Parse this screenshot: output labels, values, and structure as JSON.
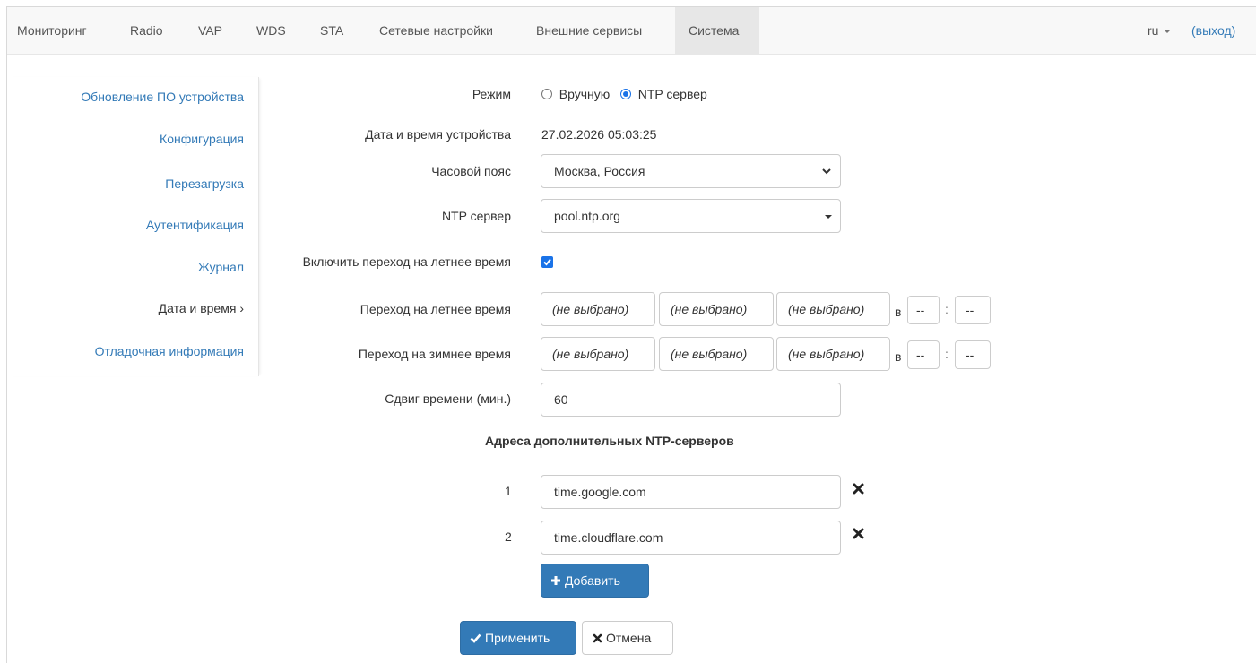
{
  "navbar": {
    "items": [
      "Мониторинг",
      "Radio",
      "VAP",
      "WDS",
      "STA",
      "Сетевые настройки",
      "Внешние сервисы",
      "Система"
    ],
    "active": "Система",
    "lang": "ru",
    "logout": "(выход)"
  },
  "sidebar": {
    "items": [
      "Обновление ПО устройства",
      "Конфигурация",
      "Перезагрузка",
      "Аутентификация",
      "Журнал",
      "Дата и время",
      "Отладочная информация"
    ],
    "current": "Дата и время",
    "current_arrow": "›"
  },
  "form": {
    "mode": {
      "label": "Режим",
      "options": [
        "Вручную",
        "NTP сервер"
      ],
      "selected": "NTP сервер"
    },
    "datetime": {
      "label": "Дата и время устройства",
      "value": "27.02.2026 05:03:25"
    },
    "timezone": {
      "label": "Часовой пояс",
      "value": "Москва, Россия"
    },
    "ntp_server": {
      "label": "NTP сервер",
      "value": "pool.ntp.org"
    },
    "dst_enable": {
      "label": "Включить переход на летнее время",
      "checked": true
    },
    "dst_start": {
      "label": "Переход на летнее время",
      "selects": [
        "(не выбрано)",
        "(не выбрано)",
        "(не выбрано)"
      ],
      "at": "в",
      "hour": "--",
      "sep": ":",
      "minute": "--"
    },
    "dst_end": {
      "label": "Переход на зимнее время",
      "selects": [
        "(не выбрано)",
        "(не выбрано)",
        "(не выбрано)"
      ],
      "at": "в",
      "hour": "--",
      "sep": ":",
      "minute": "--"
    },
    "shift": {
      "label": "Сдвиг времени (мин.)",
      "value": "60"
    },
    "extra_title": "Адреса дополнительных NTP-серверов",
    "extra_servers": [
      {
        "index": "1",
        "value": "time.google.com"
      },
      {
        "index": "2",
        "value": "time.cloudflare.com"
      }
    ],
    "add_button": "Добавить",
    "apply_button": "Применить",
    "cancel_button": "Отмена"
  },
  "colors": {
    "accent": "#337ab7",
    "checkbox": "#1a73e8",
    "navbar_bg": "#f8f8f8",
    "nav_active": "#e7e7e7"
  }
}
